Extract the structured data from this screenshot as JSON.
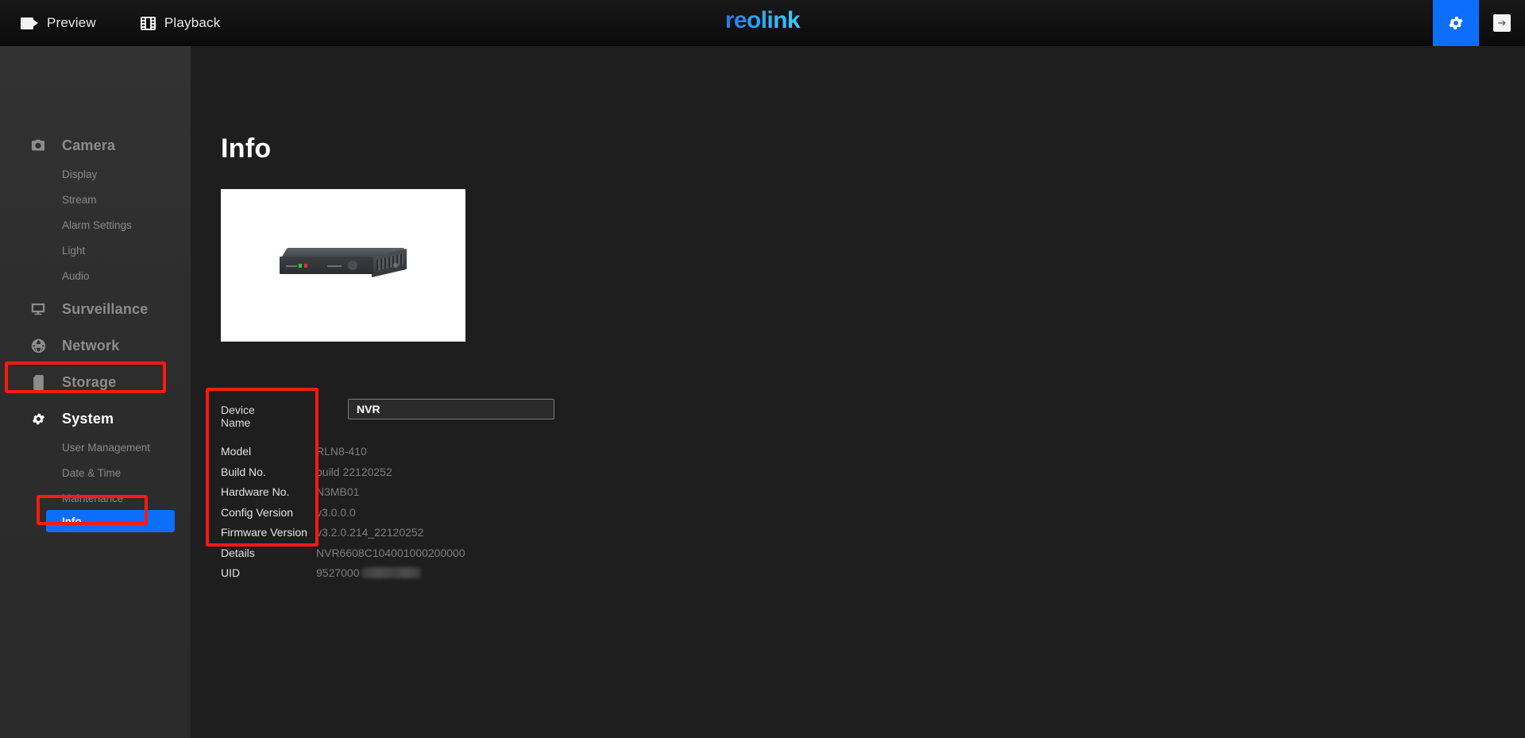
{
  "topbar": {
    "tabs": [
      {
        "label": "Preview",
        "icon": "video-camera-icon"
      },
      {
        "label": "Playback",
        "icon": "film-strip-icon"
      }
    ],
    "brand": "reolink",
    "settings_button": {
      "icon": "gear-icon"
    },
    "logout_button": {
      "icon": "logout-arrow-icon"
    },
    "accent_color": "#0d6efd"
  },
  "sidebar": {
    "groups": [
      {
        "label": "Camera",
        "icon": "camera-icon",
        "active": false,
        "items": [
          {
            "label": "Display"
          },
          {
            "label": "Stream"
          },
          {
            "label": "Alarm Settings"
          },
          {
            "label": "Light"
          },
          {
            "label": "Audio"
          }
        ]
      },
      {
        "label": "Surveillance",
        "icon": "monitor-icon",
        "active": false,
        "items": []
      },
      {
        "label": "Network",
        "icon": "globe-icon",
        "active": false,
        "items": []
      },
      {
        "label": "Storage",
        "icon": "sd-card-icon",
        "active": false,
        "items": []
      },
      {
        "label": "System",
        "icon": "gear-icon",
        "active": true,
        "items": [
          {
            "label": "User Management"
          },
          {
            "label": "Date & Time"
          },
          {
            "label": "Maintenance"
          },
          {
            "label": "Info",
            "selected": true
          }
        ]
      }
    ]
  },
  "main": {
    "title": "Info",
    "device_image_alt": "NVR device photo",
    "device_name": {
      "label": "Device Name",
      "value": "NVR",
      "placeholder": "Device Name"
    },
    "info_rows": [
      {
        "key": "Model",
        "value": "RLN8-410"
      },
      {
        "key": "Build No.",
        "value": "build 22120252"
      },
      {
        "key": "Hardware No.",
        "value": "N3MB01"
      },
      {
        "key": "Config Version",
        "value": "v3.0.0.0"
      },
      {
        "key": "Firmware Version",
        "value": "v3.2.0.214_22120252"
      },
      {
        "key": "Details",
        "value": "NVR6608C104001000200000"
      },
      {
        "key": "UID",
        "value": "9527000",
        "redacted": true
      }
    ]
  },
  "annotations": {
    "color": "#ff1a0d",
    "boxes": [
      {
        "name": "system-menu-highlight"
      },
      {
        "name": "info-menu-highlight"
      },
      {
        "name": "info-fields-highlight"
      }
    ]
  }
}
